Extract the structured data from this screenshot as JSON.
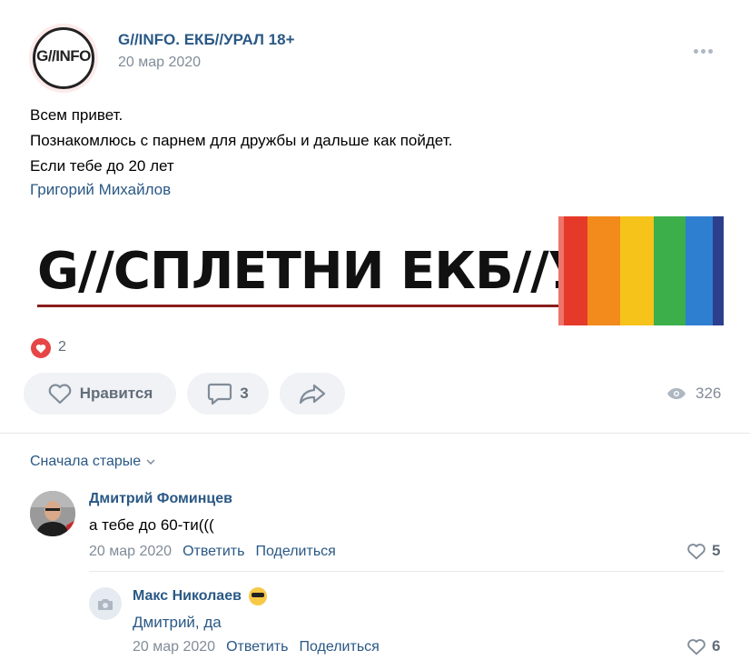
{
  "post": {
    "group_name": "G//INFO. ЕКБ//УРАЛ 18+",
    "group_logo_text": "G//INFO",
    "date": "20 мар 2020",
    "lines": [
      "Всем привет.",
      "Познакомлюсь с парнем для дружбы и дальше как пойдет.",
      "Если тебе до 20 лет"
    ],
    "author": "Григорий Михайлов",
    "banner_text": "G//СПЛЕТНИ  ЕКБ//УРАЛ",
    "reaction_count": "2",
    "like_label": "Нравится",
    "comment_count": "3",
    "views": "326"
  },
  "comments": {
    "sort_label": "Сначала старые",
    "items": [
      {
        "name": "Дмитрий Фоминцев",
        "text": "а тебе до 60-ти(((",
        "date": "20 мар 2020",
        "reply": "Ответить",
        "share": "Поделиться",
        "likes": "5"
      },
      {
        "name": "Макс Николаев",
        "text": "Дмитрий, да",
        "date": "20 мар 2020",
        "reply": "Ответить",
        "share": "Поделиться",
        "likes": "6"
      }
    ]
  },
  "colors": {
    "link": "#2a5885",
    "secondary": "#818c99",
    "button_bg": "#f0f2f5",
    "reaction": "#e64646"
  }
}
